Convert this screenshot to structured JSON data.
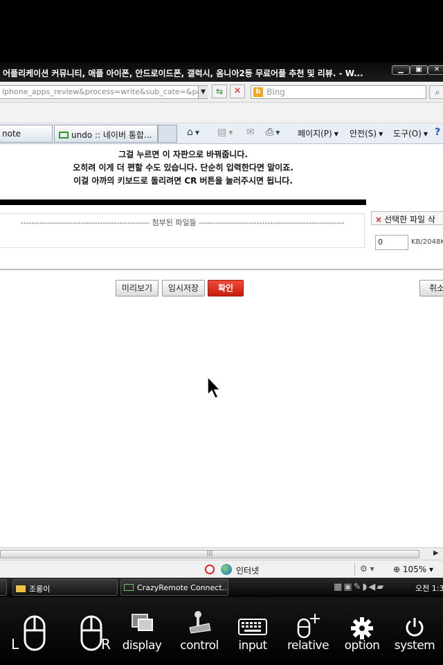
{
  "window": {
    "title": "어플리케이션 커뮤니티, 애플 아이폰, 안드로이드폰, 갤럭시, 옴니아2등 무료어플 추천 및 리뷰. - W..."
  },
  "addressbar": {
    "url": "iphone_apps_review&process=write&sub_cate=&page",
    "search_placeholder": "Bing"
  },
  "tabs": [
    {
      "label": "note"
    },
    {
      "label": "undo :: 네이버 통합..."
    }
  ],
  "commands": {
    "page": "페이지(P)",
    "safety": "안전(S)",
    "tools": "도구(O)"
  },
  "content": {
    "lines": [
      "그걸 누르면 이 자판으로 바꿔줍니다.",
      "오히려 이게 더 편할 수도 있습니다. 단순히 입력한다면 말이죠.",
      "이걸 아까의 키보드로 돌리려면 CR 버튼을 눌러주시면 됩니다."
    ],
    "attach_label": "----------------------------------------------- 첨부된 파일들 -----------------------------------------------------",
    "delete_selected": "선택한 파일 삭",
    "size_value": "0",
    "size_unit": "KB/2048K",
    "buttons": {
      "preview": "미리보기",
      "temp_save": "임시저장",
      "confirm": "확인",
      "cancel": "취소"
    }
  },
  "statusbar": {
    "zone": "인터넷",
    "zoom": "105%"
  },
  "taskbar": {
    "items": [
      {
        "label": "조롱이"
      },
      {
        "label": "CrazyRemote Connect..."
      }
    ],
    "clock": "오전 1:3"
  },
  "app_toolbar": {
    "left_mark": "L",
    "right_mark": "R",
    "items": [
      {
        "label": "display"
      },
      {
        "label": "control"
      },
      {
        "label": "input"
      },
      {
        "label": "relative"
      },
      {
        "label": "option"
      },
      {
        "label": "system"
      }
    ]
  }
}
